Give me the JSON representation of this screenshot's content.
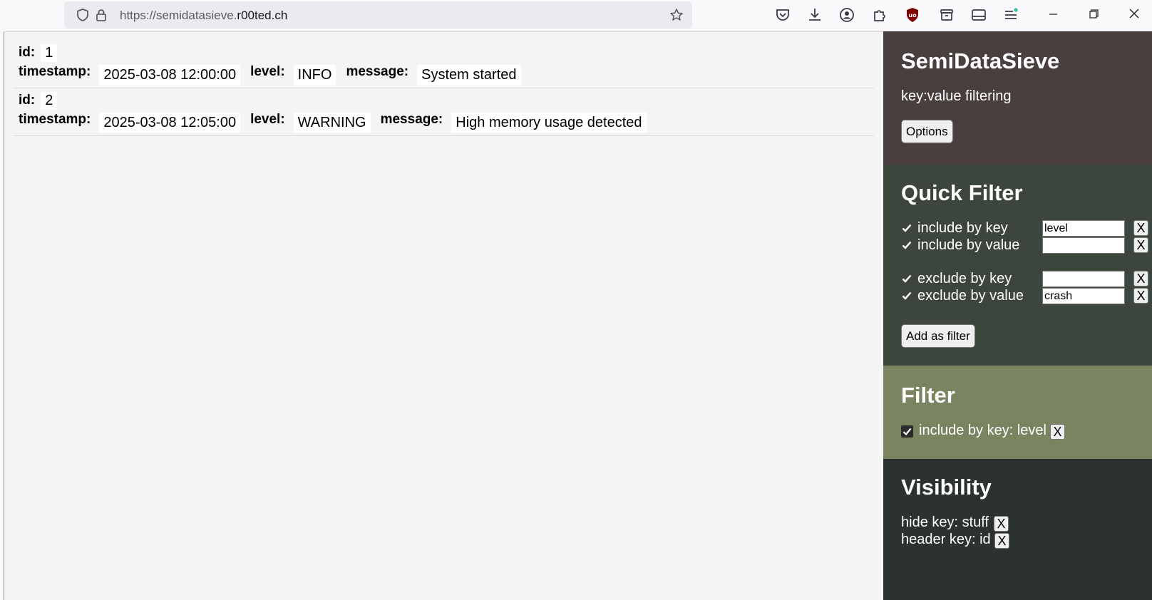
{
  "browser": {
    "url_prefix": "https://semidatasieve.",
    "url_domain": "r00ted.ch"
  },
  "records": [
    {
      "id_key": "id:",
      "id_value": "1",
      "fields": [
        {
          "key": "timestamp:",
          "value": "2025-03-08 12:00:00"
        },
        {
          "key": "level:",
          "value": "INFO"
        },
        {
          "key": "message:",
          "value": "System started"
        }
      ]
    },
    {
      "id_key": "id:",
      "id_value": "2",
      "fields": [
        {
          "key": "timestamp:",
          "value": "2025-03-08 12:05:00"
        },
        {
          "key": "level:",
          "value": "WARNING"
        },
        {
          "key": "message:",
          "value": "High memory usage detected"
        }
      ]
    }
  ],
  "sidebar": {
    "app": {
      "title": "SemiDataSieve",
      "subtitle": "key:value filtering",
      "options_label": "Options",
      "bg": "#4a3f3f"
    },
    "quick_filter": {
      "title": "Quick Filter",
      "rows": [
        {
          "label": "include by key",
          "value": "level",
          "checked": true
        },
        {
          "label": "include by value",
          "value": "",
          "checked": true
        },
        {
          "label": "exclude by key",
          "value": "",
          "checked": true
        },
        {
          "label": "exclude by value",
          "value": "crash",
          "checked": true
        }
      ],
      "remove_label": "X",
      "add_label": "Add as filter",
      "bg": "#3d463d"
    },
    "filter": {
      "title": "Filter",
      "items": [
        {
          "label": "include by key: level",
          "checked": true
        }
      ],
      "remove_label": "X",
      "bg": "#7a8460"
    },
    "visibility": {
      "title": "Visibility",
      "items": [
        {
          "label": "hide key: stuff"
        },
        {
          "label": "header key: id"
        }
      ],
      "remove_label": "X",
      "bg": "#2c3131"
    }
  }
}
